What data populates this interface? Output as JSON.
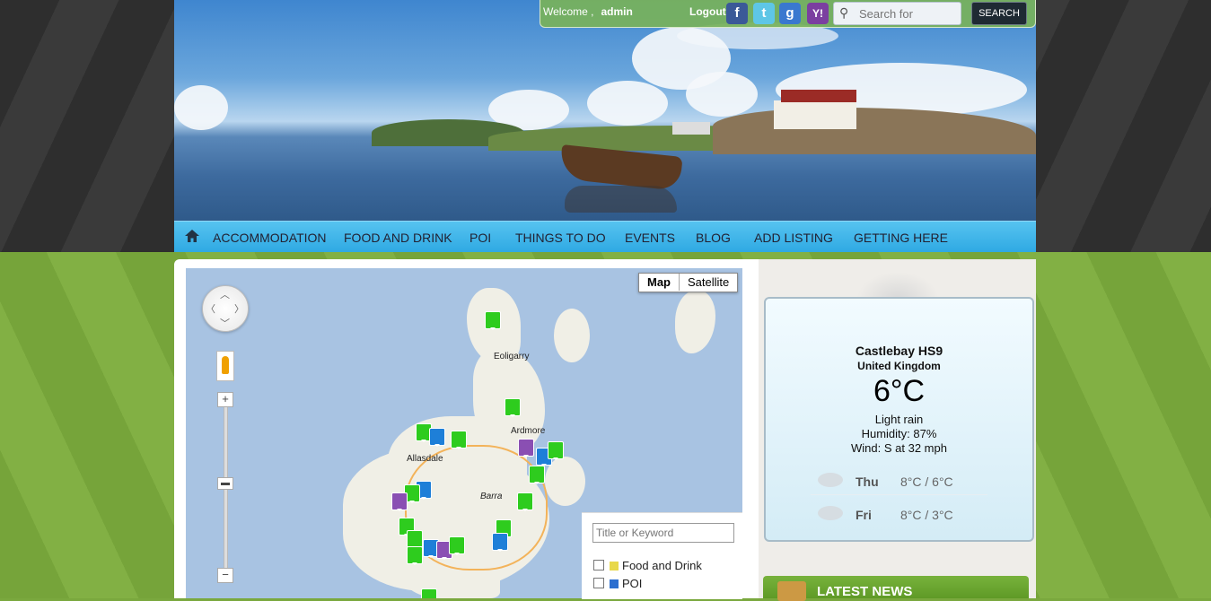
{
  "topbar": {
    "welcome": "Welcome ,",
    "username": "admin",
    "logout": "Logout",
    "social": [
      "f",
      "t",
      "g",
      "Y!"
    ],
    "search_placeholder": "Search for",
    "search_button": "SEARCH"
  },
  "nav": {
    "items": [
      "ACCOMMODATION",
      "FOOD AND DRINK",
      "POI",
      "THINGS TO DO",
      "EVENTS",
      "BLOG",
      "ADD LISTING",
      "GETTING HERE"
    ]
  },
  "map": {
    "type_buttons": [
      "Map",
      "Satellite"
    ],
    "zoom_in": "+",
    "zoom_out": "−",
    "places": [
      "Eoligarry",
      "Ardmore",
      "Allasdale",
      "Barra"
    ],
    "filter": {
      "keyword_placeholder": "Title or Keyword",
      "options": [
        "Food and Drink",
        "POI"
      ]
    }
  },
  "weather": {
    "location": "Castlebay HS9",
    "country": "United Kingdom",
    "temp": "6°C",
    "condition": "Light rain",
    "humidity": "Humidity: 87%",
    "wind": "Wind: S at 32 mph",
    "forecast": [
      {
        "day": "Thu",
        "range": "8°C / 6°C"
      },
      {
        "day": "Fri",
        "range": "8°C / 3°C"
      }
    ]
  },
  "news": {
    "title": "LATEST NEWS"
  },
  "colors": {
    "nav": "#2fa9e3",
    "topbar": "#78b25a",
    "page_green": "#7aa83e"
  }
}
